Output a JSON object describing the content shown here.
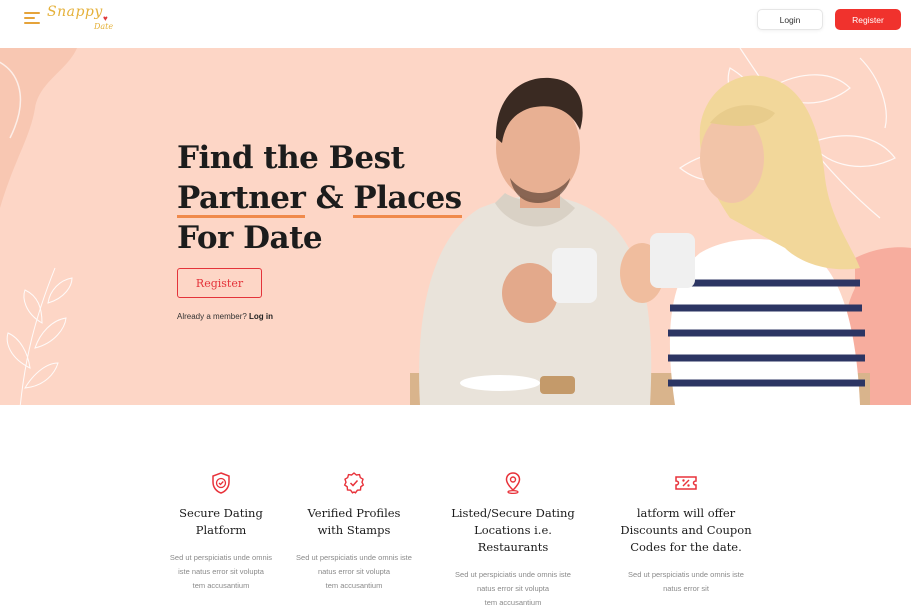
{
  "header": {
    "logo_text": "Snappy",
    "logo_sub": "Date",
    "login_label": "Login",
    "register_label": "Register"
  },
  "hero": {
    "title_line1": "Find the Best",
    "title_line2a": "Partner",
    "title_line2b": " & ",
    "title_line2c": "Places",
    "title_line3": "For Date",
    "register_label": "Register",
    "member_text": "Already a member? ",
    "login_link": "Log in"
  },
  "features": [
    {
      "icon": "shield-check-icon",
      "title_line1": "Secure Dating",
      "title_line2": "Platform",
      "desc_line1": "Sed ut perspiciatis unde omnis",
      "desc_line2": "iste natus error sit volupta",
      "desc_line3": "tem accusantium"
    },
    {
      "icon": "verified-badge-icon",
      "title_line1": "Verified Profiles",
      "title_line2": "with Stamps",
      "desc_line1": "Sed ut perspiciatis unde omnis iste",
      "desc_line2": "natus error sit volupta",
      "desc_line3": "tem accusantium"
    },
    {
      "icon": "location-pin-icon",
      "title_line1": "Listed/Secure Dating",
      "title_line2": "Locations i.e. Restaurants",
      "desc_line1": "Sed ut perspiciatis unde omnis iste",
      "desc_line2": "natus error sit volupta",
      "desc_line3": "tem accusantium"
    },
    {
      "icon": "discount-ticket-icon",
      "title_line1": "latform will offer",
      "title_line2": "Discounts and Coupon",
      "title_line3": "Codes for the date.",
      "desc_line1": "Sed ut perspiciatis unde omnis iste",
      "desc_line2": "natus error sit"
    }
  ],
  "colors": {
    "accent_red": "#f0322d",
    "hero_bg": "#fdd6c6",
    "logo_gold": "#e5b13a",
    "underline_orange": "#f08a4b"
  }
}
